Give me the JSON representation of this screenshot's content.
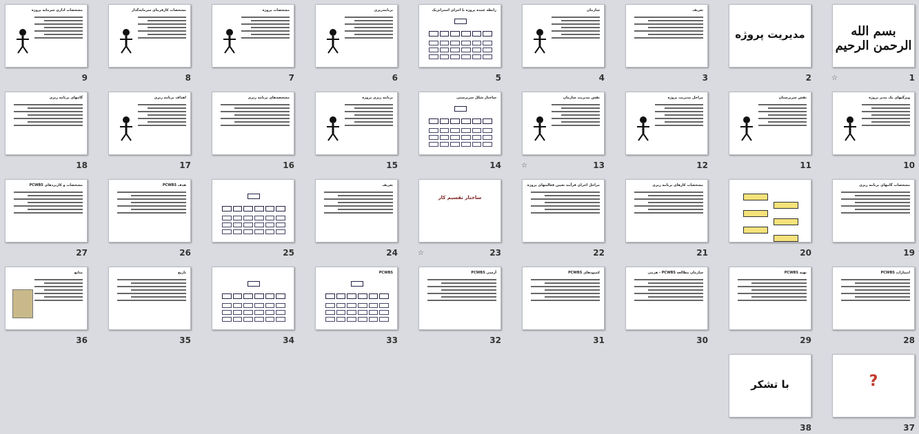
{
  "slides": [
    {
      "n": "1",
      "kind": "calligraphy",
      "title": "بسم الله الرحمن الرحیم",
      "star": true
    },
    {
      "n": "2",
      "kind": "big",
      "title": "مدیریت پروژه"
    },
    {
      "n": "3",
      "kind": "text",
      "title": "تعریف"
    },
    {
      "n": "4",
      "kind": "text-fig",
      "title": "سازمان"
    },
    {
      "n": "5",
      "kind": "diagram",
      "title": "رابطه عمده پروژه با اجزای استراتژیک"
    },
    {
      "n": "6",
      "kind": "text-fig",
      "title": "برنامه‌ریزی"
    },
    {
      "n": "7",
      "kind": "text-fig",
      "title": "مشخصات پروژه"
    },
    {
      "n": "8",
      "kind": "text-fig",
      "title": "مشخصات کارفرمای سرمایه‌گذار"
    },
    {
      "n": "9",
      "kind": "text-fig",
      "title": "مشخصات اداری سرمایه پروژه"
    },
    {
      "n": "10",
      "kind": "text-fig",
      "title": "ویژگیهای یک مدیر پروژه"
    },
    {
      "n": "11",
      "kind": "text-fig",
      "title": "نقش سرپرستان"
    },
    {
      "n": "12",
      "kind": "text-fig",
      "title": "مراحل مدیریت پروژه"
    },
    {
      "n": "13",
      "kind": "text-fig",
      "title": "نقش مدیریت سازمان",
      "star": true
    },
    {
      "n": "14",
      "kind": "org",
      "title": "ساختار شکل سرپرستی"
    },
    {
      "n": "15",
      "kind": "text-fig",
      "title": "برنامه ریزی پروژه"
    },
    {
      "n": "16",
      "kind": "text",
      "title": "مشخصه‌های برنامه ریزی"
    },
    {
      "n": "17",
      "kind": "text-fig",
      "title": "اهداف برنامه ریزی"
    },
    {
      "n": "18",
      "kind": "text",
      "title": "گامهای برنامه ریزی"
    },
    {
      "n": "19",
      "kind": "text",
      "title": "مشخصات گامهای برنامه ریزی"
    },
    {
      "n": "20",
      "kind": "chart",
      "title": ""
    },
    {
      "n": "21",
      "kind": "text",
      "title": "مشخصات کارهای برنامه ریزی"
    },
    {
      "n": "22",
      "kind": "text",
      "title": "مراحل اجرای فرآیند تعیین فعالیتهای پروژه"
    },
    {
      "n": "23",
      "kind": "center",
      "title": "ساختار تقسیم کار",
      "star": true
    },
    {
      "n": "24",
      "kind": "text",
      "title": "تعریف"
    },
    {
      "n": "25",
      "kind": "org",
      "title": ""
    },
    {
      "n": "26",
      "kind": "text",
      "title": "هدف PCWBS"
    },
    {
      "n": "27",
      "kind": "text",
      "title": "مشخصات و کاربردهای PCWBS"
    },
    {
      "n": "28",
      "kind": "text",
      "title": "امتیازات PCWBS"
    },
    {
      "n": "29",
      "kind": "text",
      "title": "تهیه PCWBS"
    },
    {
      "n": "30",
      "kind": "text",
      "title": "سازمان مطالعه PCWBS - هرمی"
    },
    {
      "n": "31",
      "kind": "text",
      "title": "کمبودهای PCWBS"
    },
    {
      "n": "32",
      "kind": "text",
      "title": "آرسی PCWBS"
    },
    {
      "n": "33",
      "kind": "org",
      "title": "PCWBS"
    },
    {
      "n": "34",
      "kind": "org",
      "title": ""
    },
    {
      "n": "35",
      "kind": "text",
      "title": "تاریخ"
    },
    {
      "n": "36",
      "kind": "book",
      "title": "منابع"
    },
    {
      "n": "37",
      "kind": "question",
      "title": ""
    },
    {
      "n": "38",
      "kind": "big",
      "title": "با تشکر"
    }
  ]
}
